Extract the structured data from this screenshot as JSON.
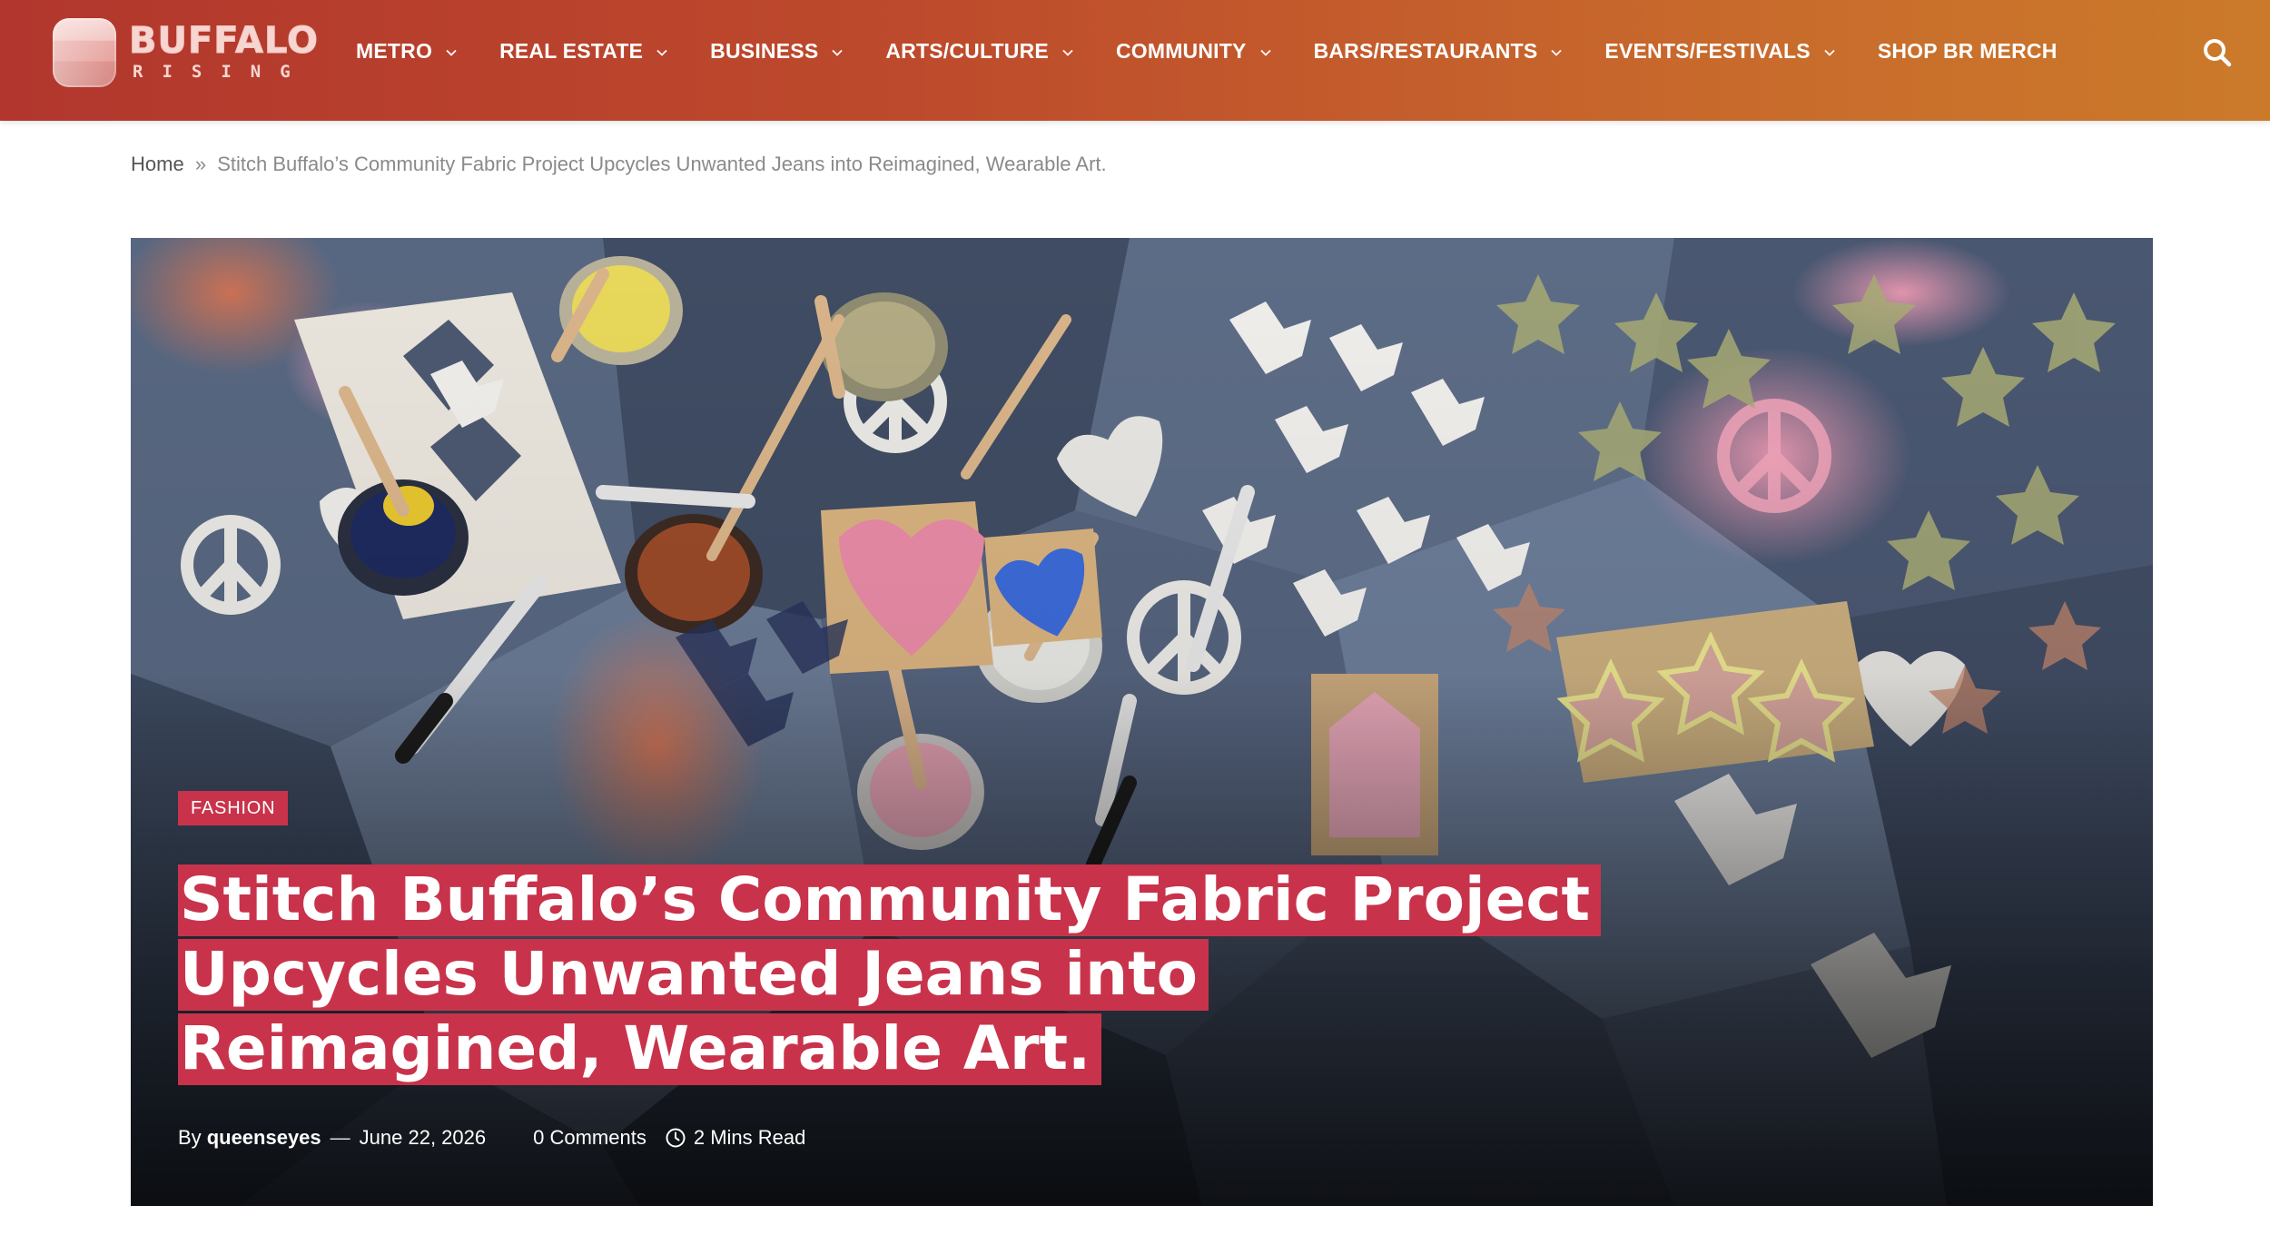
{
  "site": {
    "logo_word": "BUFFALO",
    "logo_sub": "RISING",
    "logo_icon": "logo-mark"
  },
  "nav": {
    "items": [
      {
        "label": "METRO",
        "has_dropdown": true
      },
      {
        "label": "REAL ESTATE",
        "has_dropdown": true
      },
      {
        "label": "BUSINESS",
        "has_dropdown": true
      },
      {
        "label": "ARTS/CULTURE",
        "has_dropdown": true
      },
      {
        "label": "COMMUNITY",
        "has_dropdown": true
      },
      {
        "label": "BARS/RESTAURANTS",
        "has_dropdown": true
      },
      {
        "label": "EVENTS/FESTIVALS",
        "has_dropdown": true
      },
      {
        "label": "SHOP BR MERCH",
        "has_dropdown": false
      }
    ],
    "search_icon": "search-icon"
  },
  "breadcrumb": {
    "home": "Home",
    "separator": "»",
    "current": "Stitch Buffalo’s Community Fabric Project Upcycles Unwanted Jeans into Reimagined, Wearable Art."
  },
  "article": {
    "category": "FASHION",
    "title": "Stitch Buffalo’s Community Fabric Project Upcycles Unwanted Jeans into Reimagined, Wearable Art.",
    "by_label": "By",
    "author": "queenseyes",
    "dash": "—",
    "date": "June 22, 2026",
    "comments": "0 Comments",
    "read_time": "2 Mins Read"
  },
  "colors": {
    "header_start": "#b2362d",
    "header_end": "#cb7a2a",
    "accent": "#c8334b",
    "breadcrumb_text": "#8a8a8a"
  }
}
